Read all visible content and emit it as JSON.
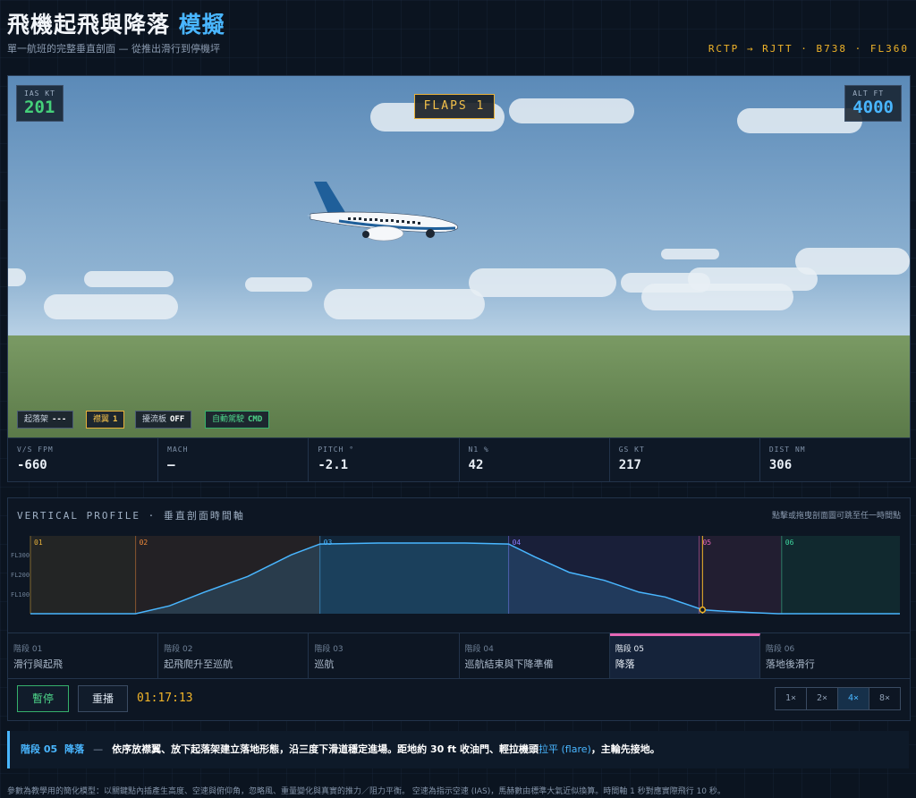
{
  "header": {
    "title_main": "飛機起飛與降落",
    "title_accent": "模擬",
    "subtitle": "單一航班的完整垂直剖面 — 從推出滑行到停機坪",
    "route": "RCTP → RJTT · B738 · FL360"
  },
  "hud": {
    "ias": {
      "label": "IAS KT",
      "value": "201",
      "color": "#45d07a"
    },
    "alt": {
      "label": "ALT FT",
      "value": "4000",
      "color": "#49b6ff"
    },
    "flaps": "FLAPS 1",
    "chips": [
      {
        "label": "起落架",
        "value": "---"
      },
      {
        "label": "襟翼",
        "value": "1"
      },
      {
        "label": "擾流板",
        "value": "OFF"
      },
      {
        "label": "自動駕駛",
        "value": "CMD"
      }
    ]
  },
  "readouts": [
    {
      "label": "V/S FPM",
      "value": "-660"
    },
    {
      "label": "MACH",
      "value": "—"
    },
    {
      "label": "PITCH °",
      "value": "-2.1"
    },
    {
      "label": "N1 %",
      "value": "42"
    },
    {
      "label": "GS KT",
      "value": "217"
    },
    {
      "label": "DIST NM",
      "value": "306"
    }
  ],
  "profile": {
    "title": "VERTICAL PROFILE · 垂直剖面時間軸",
    "hint": "點擊或拖曳剖面圖可跳至任一時間點"
  },
  "chart_data": {
    "type": "area",
    "y_ticks": [
      "FL300",
      "FL200",
      "FL100"
    ],
    "ylim": [
      0,
      360
    ],
    "current_time_fraction": 0.773,
    "phase_bands": [
      {
        "id": "01",
        "start": 0.0,
        "end": 0.121,
        "color": "#e8b13a"
      },
      {
        "id": "02",
        "start": 0.121,
        "end": 0.333,
        "color": "#f08a3a"
      },
      {
        "id": "03",
        "start": 0.333,
        "end": 0.55,
        "color": "#49b6ff"
      },
      {
        "id": "04",
        "start": 0.55,
        "end": 0.769,
        "color": "#8a7aff"
      },
      {
        "id": "05",
        "start": 0.769,
        "end": 0.864,
        "color": "#e567b5"
      },
      {
        "id": "06",
        "start": 0.864,
        "end": 1.0,
        "color": "#3fd7a0"
      }
    ],
    "x": [
      0,
      0.121,
      0.16,
      0.2,
      0.25,
      0.3,
      0.333,
      0.4,
      0.5,
      0.55,
      0.58,
      0.62,
      0.66,
      0.7,
      0.73,
      0.76,
      0.773,
      0.8,
      0.83,
      0.86,
      0.9,
      1.0
    ],
    "values": [
      0,
      0,
      40,
      110,
      190,
      300,
      355,
      360,
      360,
      355,
      290,
      210,
      170,
      110,
      85,
      40,
      20,
      12,
      6,
      0,
      0,
      0
    ]
  },
  "phases": [
    {
      "num": "階段 01",
      "name": "滑行與起飛"
    },
    {
      "num": "階段 02",
      "name": "起飛爬升至巡航"
    },
    {
      "num": "階段 03",
      "name": "巡航"
    },
    {
      "num": "階段 04",
      "name": "巡航結束與下降準備"
    },
    {
      "num": "階段 05",
      "name": "降落"
    },
    {
      "num": "階段 06",
      "name": "落地後滑行"
    }
  ],
  "controls": {
    "pause": "暫停",
    "replay": "重播",
    "clock": "01:17:13",
    "speeds": [
      "1×",
      "2×",
      "4×",
      "8×"
    ],
    "active_speed": "4×"
  },
  "description": {
    "phase_id": "階段 05",
    "phase_name": "降落",
    "dash": "—",
    "bold_text": "依序放襟翼、放下起落架建立落地形態，沿三度下滑道穩定進場。距地約 30 ft 收油門、輕拉機頭",
    "highlight": "拉平 (flare)",
    "tail": "，主輪先接地。"
  },
  "footer": "參數為教學用的簡化模型：以關鍵點內插產生高度、空速與俯仰角，忽略風、重量變化與真實的推力／阻力平衡。 空速為指示空速 (IAS)，馬赫數由標準大氣近似換算。時間軸 1 秒對應實際飛行 10 秒。"
}
